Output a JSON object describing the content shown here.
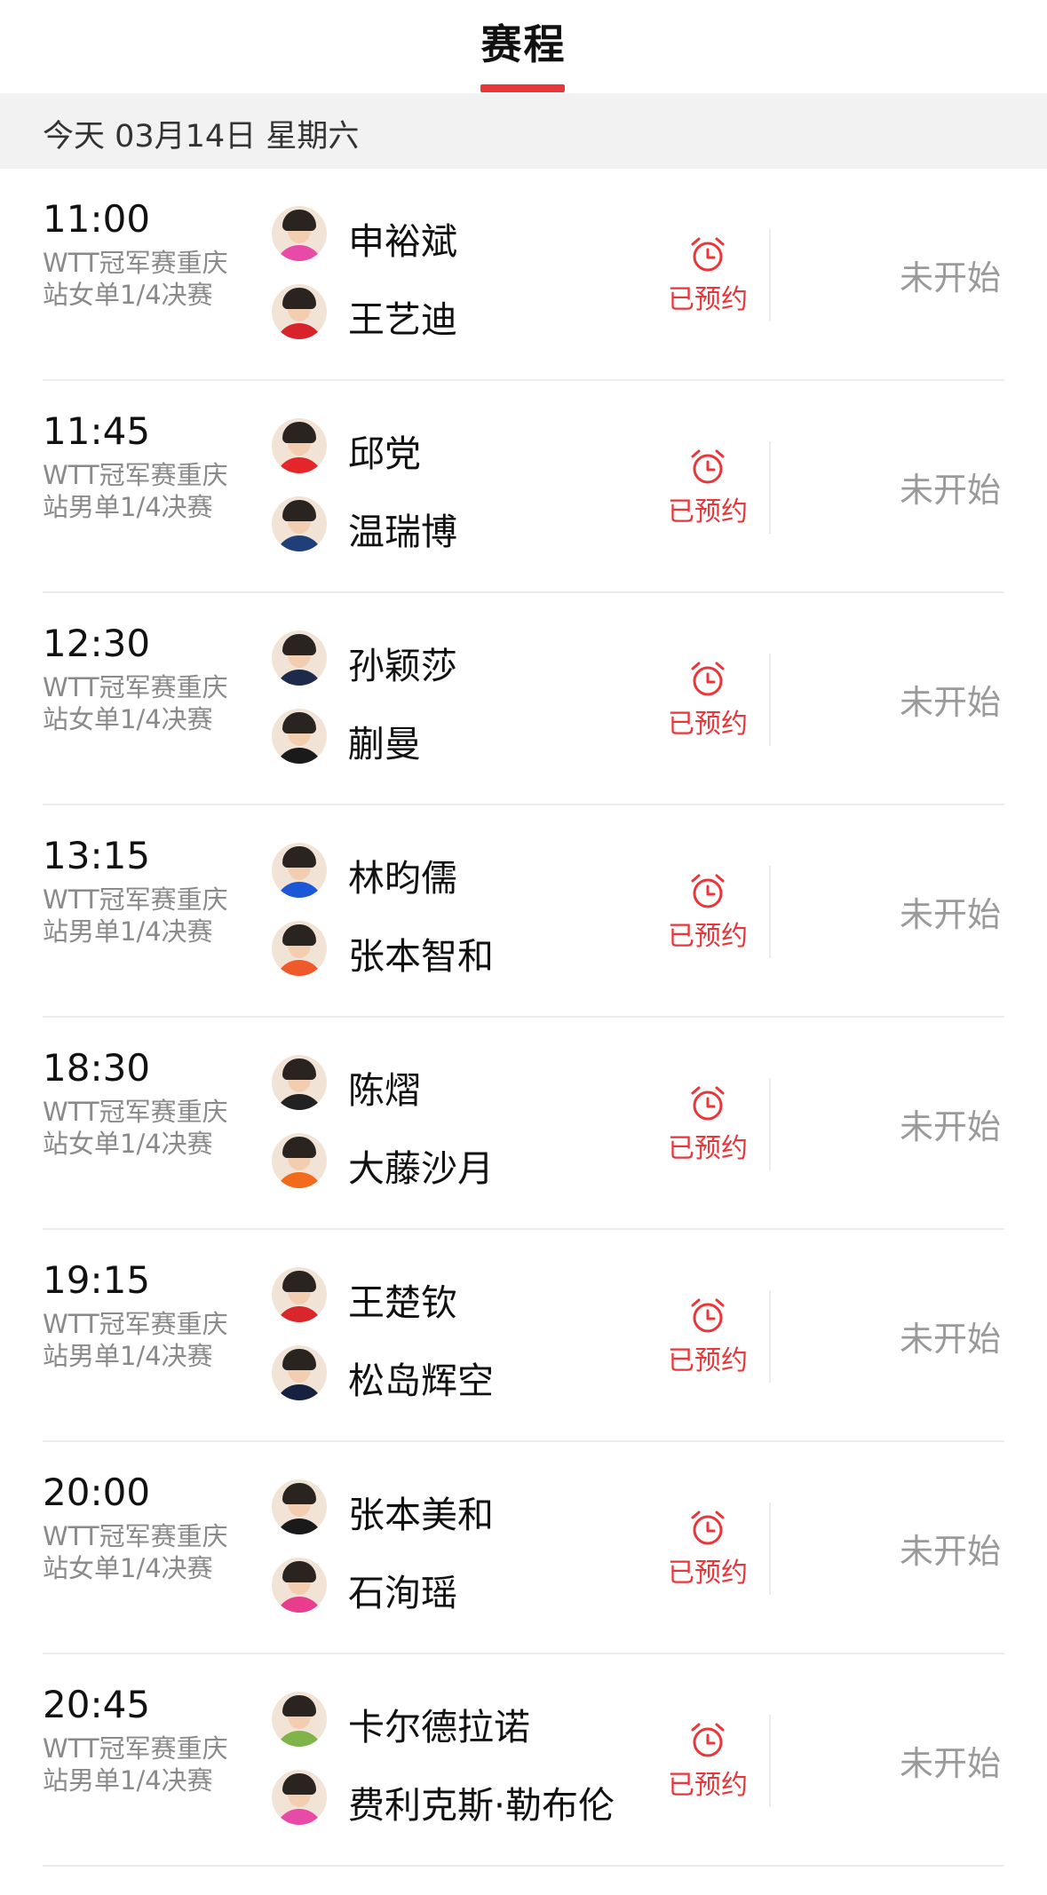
{
  "header": {
    "title": "赛程"
  },
  "date_bar": {
    "text": "今天 03月14日 星期六"
  },
  "colors": {
    "accent": "#e8363a",
    "status_gray": "#9a9a9a"
  },
  "matches": [
    {
      "time": "11:00",
      "desc": "WTT冠军赛重庆站女单1/4决赛",
      "p1": {
        "name": "申裕斌",
        "shirt": "#e84aa8"
      },
      "p2": {
        "name": "王艺迪",
        "shirt": "#d8232a"
      },
      "reminder": "已预约",
      "status": "未开始"
    },
    {
      "time": "11:45",
      "desc": "WTT冠军赛重庆站男单1/4决赛",
      "p1": {
        "name": "邱党",
        "shirt": "#e4262b"
      },
      "p2": {
        "name": "温瑞博",
        "shirt": "#1f3f7a"
      },
      "reminder": "已预约",
      "status": "未开始"
    },
    {
      "time": "12:30",
      "desc": "WTT冠军赛重庆站女单1/4决赛",
      "p1": {
        "name": "孙颖莎",
        "shirt": "#1d2a4a"
      },
      "p2": {
        "name": "蒯曼",
        "shirt": "#1a1a1a"
      },
      "reminder": "已预约",
      "status": "未开始"
    },
    {
      "time": "13:15",
      "desc": "WTT冠军赛重庆站男单1/4决赛",
      "p1": {
        "name": "林昀儒",
        "shirt": "#1b57d6"
      },
      "p2": {
        "name": "张本智和",
        "shirt": "#f05a2a"
      },
      "reminder": "已预约",
      "status": "未开始"
    },
    {
      "time": "18:30",
      "desc": "WTT冠军赛重庆站女单1/4决赛",
      "p1": {
        "name": "陈熠",
        "shirt": "#222222"
      },
      "p2": {
        "name": "大藤沙月",
        "shirt": "#f26a1b"
      },
      "reminder": "已预约",
      "status": "未开始"
    },
    {
      "time": "19:15",
      "desc": "WTT冠军赛重庆站男单1/4决赛",
      "p1": {
        "name": "王楚钦",
        "shirt": "#d9262b"
      },
      "p2": {
        "name": "松岛辉空",
        "shirt": "#15213f"
      },
      "reminder": "已预约",
      "status": "未开始"
    },
    {
      "time": "20:00",
      "desc": "WTT冠军赛重庆站女单1/4决赛",
      "p1": {
        "name": "张本美和",
        "shirt": "#1a1a1a"
      },
      "p2": {
        "name": "石洵瑶",
        "shirt": "#e83c8c"
      },
      "reminder": "已预约",
      "status": "未开始"
    },
    {
      "time": "20:45",
      "desc": "WTT冠军赛重庆站男单1/4决赛",
      "p1": {
        "name": "卡尔德拉诺",
        "shirt": "#7fb548"
      },
      "p2": {
        "name": "费利克斯·勒布伦",
        "shirt": "#e84aa8"
      },
      "reminder": "已预约",
      "status": "未开始"
    }
  ]
}
